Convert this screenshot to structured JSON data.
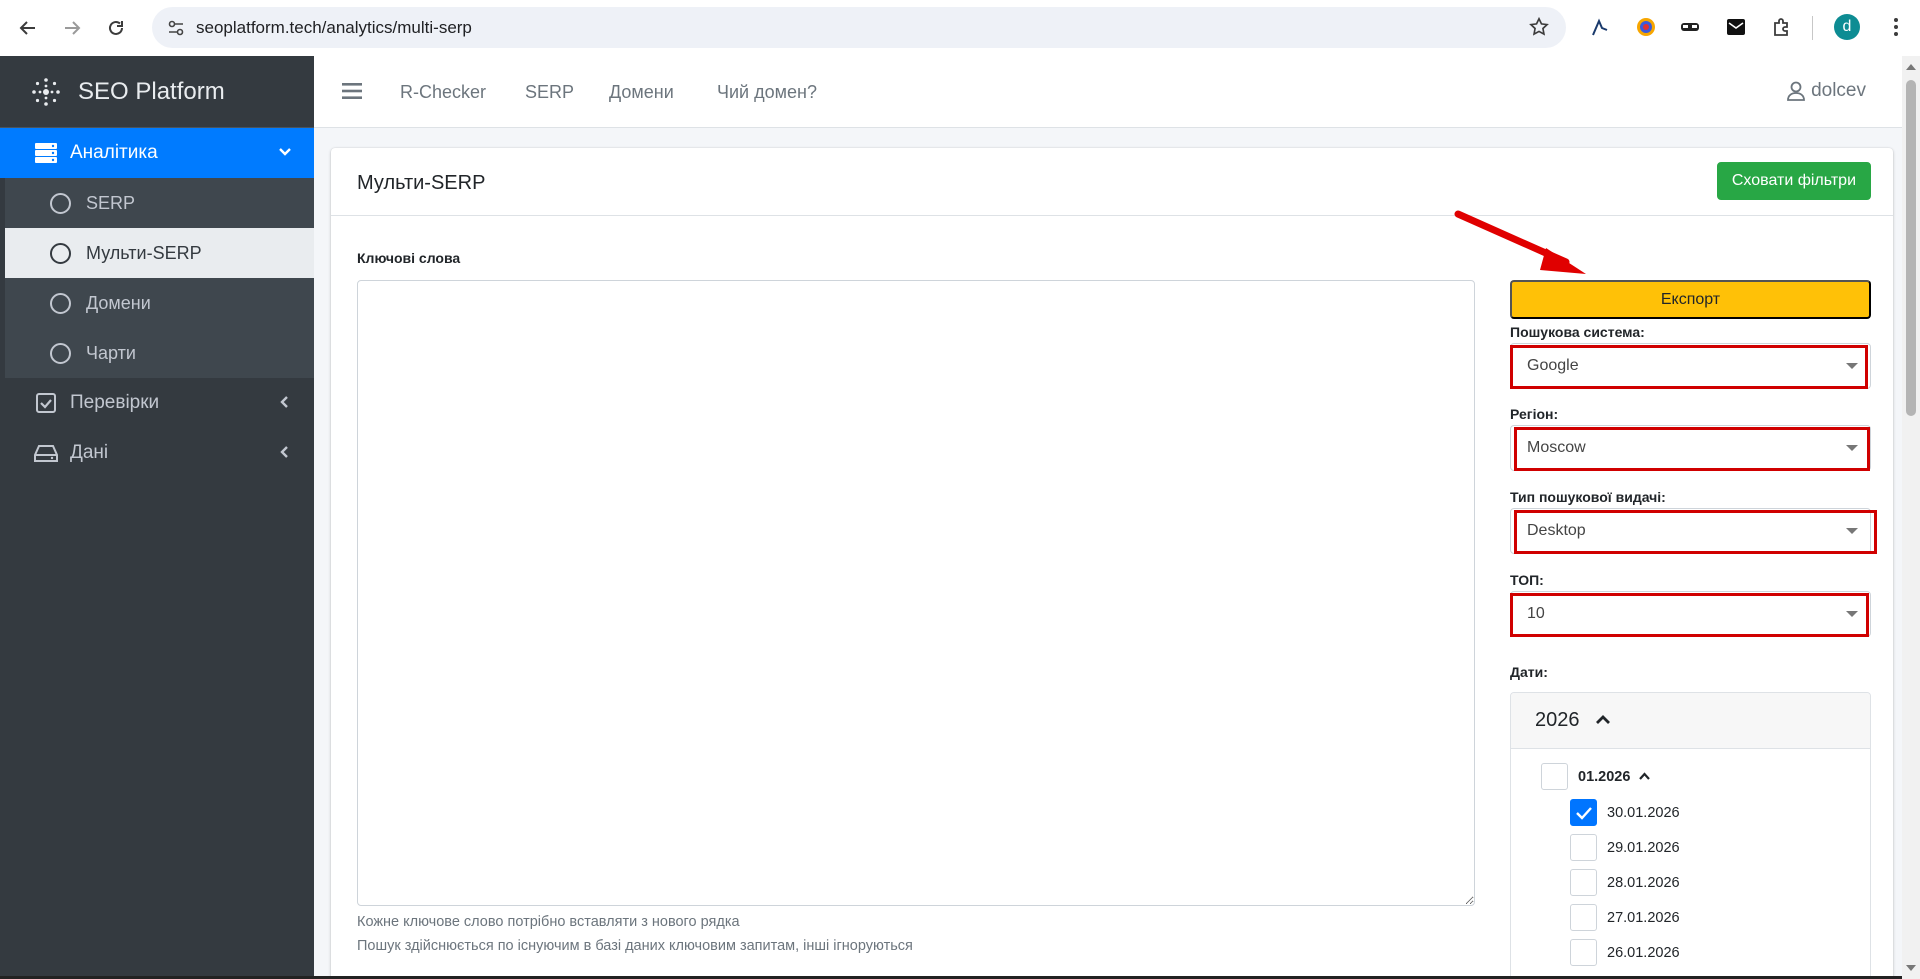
{
  "browser": {
    "url": "seoplatform.tech/analytics/multi-serp",
    "avatar_letter": "d"
  },
  "sidebar": {
    "brand": "SEO Platform",
    "analytics_label": "Аналітика",
    "sub_items": [
      {
        "label": "SERP"
      },
      {
        "label": "Мульти-SERP"
      },
      {
        "label": "Домени"
      },
      {
        "label": "Чарти"
      }
    ],
    "checks_label": "Перевірки",
    "data_label": "Дані"
  },
  "topbar": {
    "links": [
      "R-Checker",
      "SERP",
      "Домени",
      "Чий домен?"
    ],
    "user": "dolcev"
  },
  "card": {
    "title": "Мульти-SERP",
    "hide_filters_label": "Сховати фільтри",
    "keywords_label": "Ключові слова",
    "help_line_1": "Кожне ключове слово потрібно вставляти з нового рядка",
    "help_line_2": "Пошук здійснюється по існуючим в базі даних ключовим запитам, інші ігноруються"
  },
  "filters": {
    "export_label": "Експорт",
    "engine_label": "Пошукова система:",
    "engine_value": "Google",
    "region_label": "Регіон:",
    "region_value": "Moscow",
    "serp_type_label": "Тип пошукової видачі:",
    "serp_type_value": "Desktop",
    "top_label": "ТОП:",
    "top_value": "10",
    "dates_label": "Дати:"
  },
  "dates": {
    "year": "2026",
    "month": "01.2026",
    "days": [
      {
        "label": "30.01.2026",
        "checked": true
      },
      {
        "label": "29.01.2026",
        "checked": false
      },
      {
        "label": "28.01.2026",
        "checked": false
      },
      {
        "label": "27.01.2026",
        "checked": false
      },
      {
        "label": "26.01.2026",
        "checked": false
      }
    ]
  },
  "colors": {
    "sidebar_bg": "#343a40",
    "primary": "#007bff",
    "success": "#28a745",
    "warning": "#ffc107",
    "highlight": "#d00000"
  }
}
